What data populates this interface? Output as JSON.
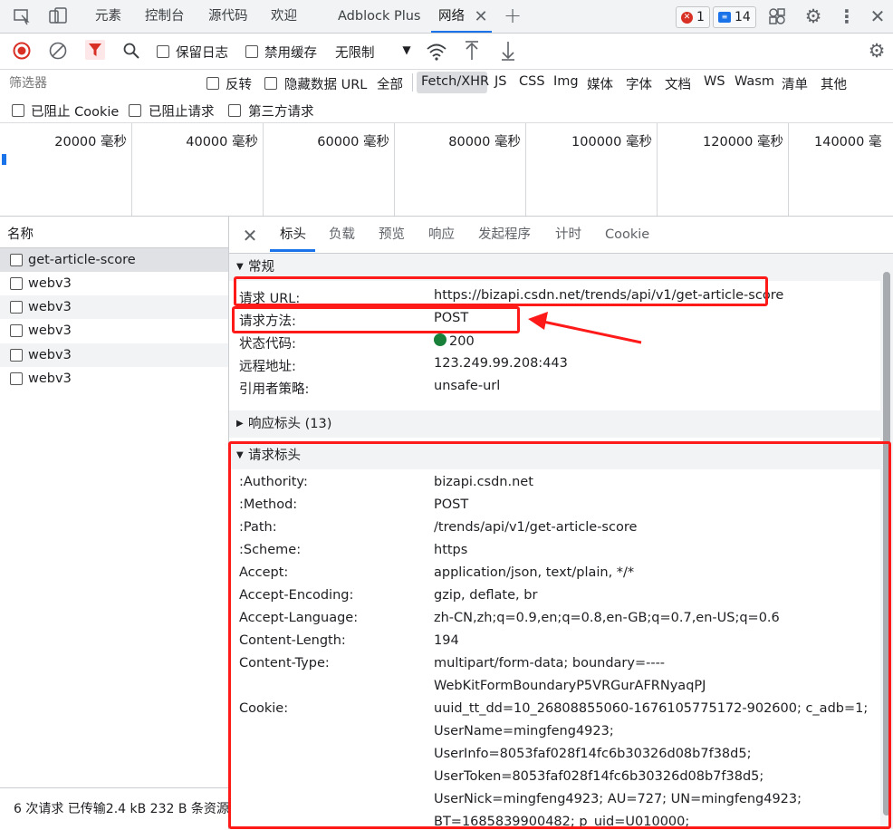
{
  "tabs": {
    "elements": "元素",
    "console": "控制台",
    "sources": "源代码",
    "welcome": "欢迎",
    "adblock": "Adblock Plus",
    "network": "网络"
  },
  "badges": {
    "errors": "1",
    "messages": "14"
  },
  "toolbar": {
    "preserve_log": "保留日志",
    "disable_cache": "禁用缓存",
    "throttling": "无限制"
  },
  "filter": {
    "placeholder": "筛选器",
    "invert": "反转",
    "hide_data_url": "隐藏数据 URL",
    "all": "全部",
    "types": [
      "Fetch/XHR",
      "JS",
      "CSS",
      "Img",
      "媒体",
      "字体",
      "文档",
      "WS",
      "Wasm",
      "清单",
      "其他"
    ],
    "blocked_cookies": "已阻止 Cookie",
    "blocked_requests": "已阻止请求",
    "third_party": "第三方请求"
  },
  "timeline": {
    "labels": [
      "20000  毫秒",
      "40000  毫秒",
      "60000  毫秒",
      "80000  毫秒",
      "100000  毫秒",
      "120000  毫秒",
      "140000  毫"
    ]
  },
  "request_list": {
    "header": "名称",
    "items": [
      "get-article-score",
      "webv3",
      "webv3",
      "webv3",
      "webv3",
      "webv3"
    ],
    "status_bar": "6 次请求  已传输2.4 kB  232 B 条资源"
  },
  "detail_tabs": [
    "标头",
    "负载",
    "预览",
    "响应",
    "发起程序",
    "计时",
    "Cookie"
  ],
  "general": {
    "title": "常规",
    "rows": [
      {
        "k": "请求 URL:",
        "v": "https://bizapi.csdn.net/trends/api/v1/get-article-score"
      },
      {
        "k": "请求方法:",
        "v": "POST"
      },
      {
        "k": "状态代码:",
        "v": "200"
      },
      {
        "k": "远程地址:",
        "v": "123.249.99.208:443"
      },
      {
        "k": "引用者策略:",
        "v": "unsafe-url"
      }
    ]
  },
  "response_headers": {
    "title": "响应标头 (13)"
  },
  "request_headers": {
    "title": "请求标头",
    "rows": [
      {
        "k": ":Authority:",
        "v": "bizapi.csdn.net"
      },
      {
        "k": ":Method:",
        "v": "POST"
      },
      {
        "k": ":Path:",
        "v": "/trends/api/v1/get-article-score"
      },
      {
        "k": ":Scheme:",
        "v": "https"
      },
      {
        "k": "Accept:",
        "v": "application/json, text/plain, */*"
      },
      {
        "k": "Accept-Encoding:",
        "v": "gzip, deflate, br"
      },
      {
        "k": "Accept-Language:",
        "v": "zh-CN,zh;q=0.9,en;q=0.8,en-GB;q=0.7,en-US;q=0.6"
      },
      {
        "k": "Content-Length:",
        "v": "194"
      },
      {
        "k": "Content-Type:",
        "v": "multipart/form-data; boundary=----"
      },
      {
        "k": "",
        "v": "WebKitFormBoundaryP5VRGurAFRNyaqPJ"
      },
      {
        "k": "Cookie:",
        "v": "uuid_tt_dd=10_26808855060-1676105775172-902600; c_adb=1;"
      },
      {
        "k": "",
        "v": "UserName=mingfeng4923;"
      },
      {
        "k": "",
        "v": "UserInfo=8053faf028f14fc6b30326d08b7f38d5;"
      },
      {
        "k": "",
        "v": "UserToken=8053faf028f14fc6b30326d08b7f38d5;"
      },
      {
        "k": "",
        "v": "UserNick=mingfeng4923; AU=727; UN=mingfeng4923;"
      },
      {
        "k": "",
        "v": "BT=1685839900482; p_uid=U010000;"
      }
    ]
  },
  "colors": {
    "accent": "#1a73e8",
    "annotation": "#ff1a1a",
    "status_ok": "#188038",
    "record": "#d93025"
  }
}
